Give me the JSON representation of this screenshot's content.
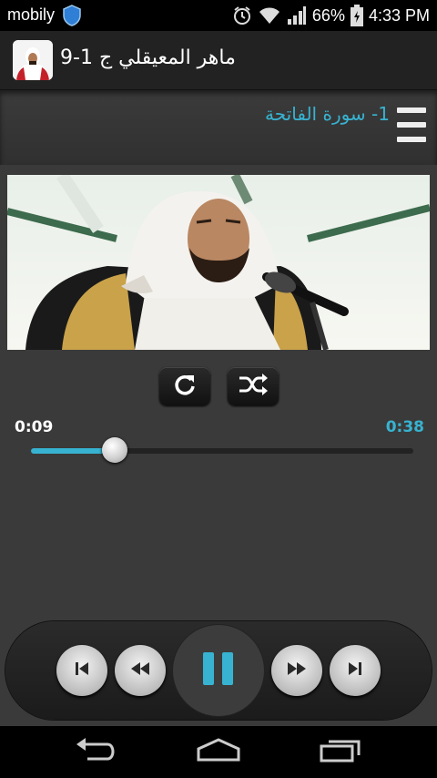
{
  "status_bar": {
    "carrier": "mobily",
    "battery": "66%",
    "time": "4:33 PM"
  },
  "action_bar": {
    "title": "ماهر المعيقلي ج 1-9",
    "icon": "reciter-app-icon"
  },
  "track": {
    "title": "1- سورة الفاتحة"
  },
  "player": {
    "current_time": "0:09",
    "total_time": "0:38",
    "progress": 0.22,
    "state": "playing"
  },
  "icons": {
    "repeat": "repeat-icon",
    "shuffle": "shuffle-icon",
    "prev": "skip-previous-icon",
    "rewind": "rewind-icon",
    "pause": "pause-icon",
    "forward": "fast-forward-icon",
    "next": "skip-next-icon",
    "back": "back-icon",
    "home": "home-icon",
    "recents": "recents-icon"
  },
  "colors": {
    "accent": "#37b3d1",
    "background": "#3a3a3a",
    "bar": "#222222"
  }
}
